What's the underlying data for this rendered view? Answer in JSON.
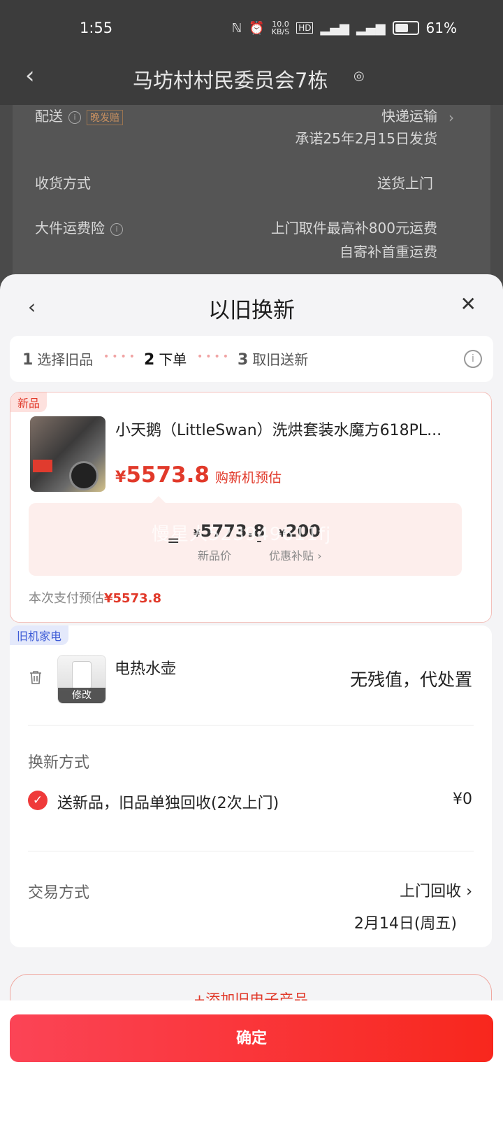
{
  "status_bar": {
    "time": "1:55",
    "network_speed": "10.0",
    "network_speed_unit": "KB/S",
    "battery": "61%",
    "icons": [
      "nfc-icon",
      "alarm-icon",
      "hd-icon",
      "signal-5g-icon",
      "signal-5g-icon",
      "battery-icon"
    ]
  },
  "background_page": {
    "title": "马坊村村民委员会7栋",
    "rows": [
      {
        "label": "配送",
        "tag": "晚发赔",
        "value": "快递运输",
        "sub": "承诺25年2月15日发货"
      },
      {
        "label": "收货方式",
        "value": "送货上门"
      },
      {
        "label": "大件运费险",
        "value": "上门取件最高补800元运费",
        "sub": "自寄补首重运费"
      }
    ]
  },
  "sheet": {
    "title": "以旧换新",
    "steps": [
      {
        "num": "1",
        "label": "选择旧品"
      },
      {
        "num": "2",
        "label": "下单"
      },
      {
        "num": "3",
        "label": "取旧送新"
      }
    ]
  },
  "new_product": {
    "tag": "新品",
    "name": "小天鹅（LittleSwan）洗烘套装水魔方618PL...",
    "currency": "¥",
    "price": "5573.8",
    "price_note": "购新机预估",
    "calc": {
      "new_price_currency": "¥",
      "new_price": "5773.8",
      "new_price_label": "新品价",
      "subsidy_currency": "¥",
      "subsidy": "200",
      "subsidy_label": "优惠补贴 ›",
      "eq": "=",
      "minus": "-"
    },
    "watermark": "慢星人523949611fj",
    "pay_label": "本次支付预估",
    "pay_amount": "¥5573.8"
  },
  "old_item": {
    "tag": "旧机家电",
    "name": "电热水壶",
    "edit_label": "修改",
    "value": "无残值，代处置",
    "method_title": "换新方式",
    "method_label": "送新品，旧品单独回收(2次上门)",
    "method_price": "¥0",
    "trade_title": "交易方式",
    "trade_value": "上门回收",
    "trade_date": "2月14日(周五)"
  },
  "add_old_label": "+添加旧电子产品",
  "confirm_label": "确定",
  "colors": {
    "accent": "#e1392a",
    "button_start": "#fb4456",
    "button_end": "#f8271d"
  }
}
